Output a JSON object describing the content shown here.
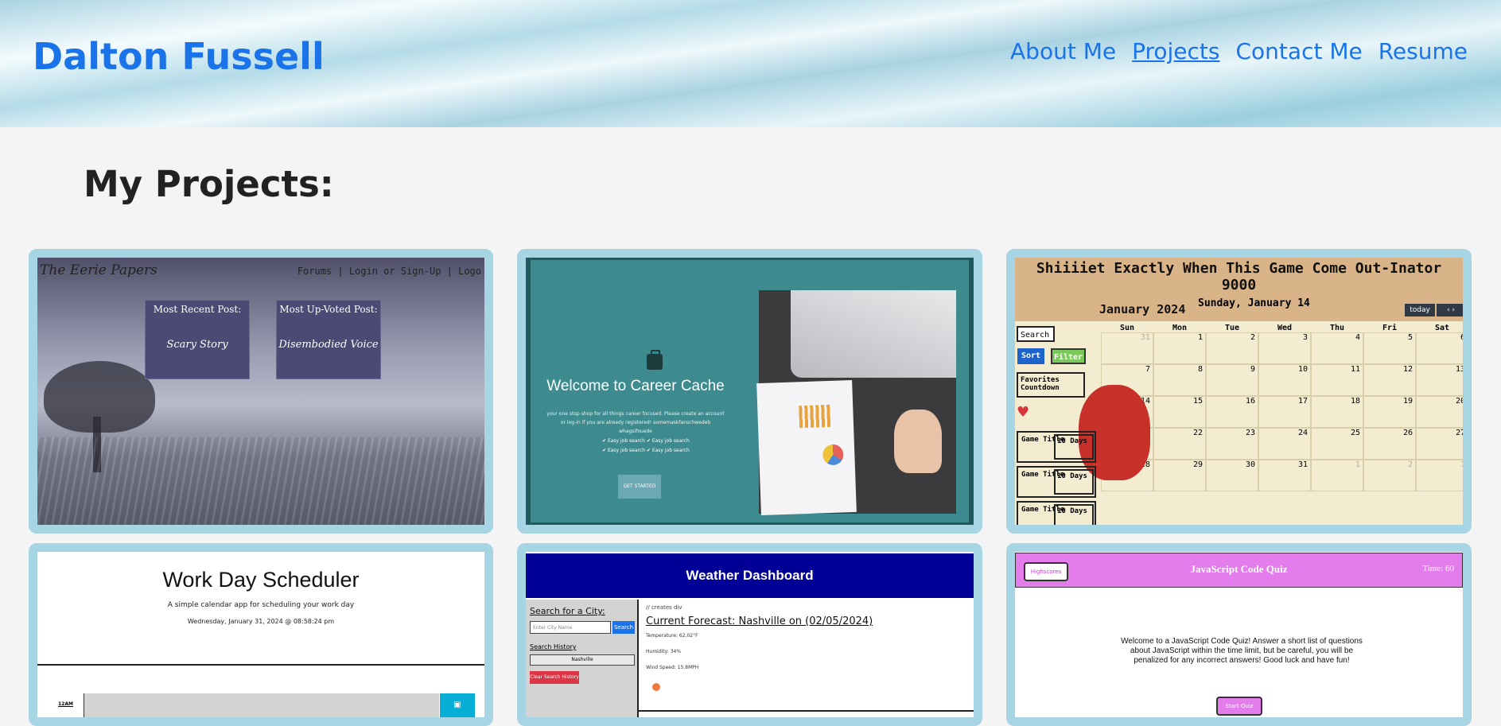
{
  "header": {
    "site_title": "Dalton Fussell",
    "nav": [
      "About Me",
      "Projects",
      "Contact Me",
      "Resume"
    ],
    "active_nav": "Projects"
  },
  "main": {
    "section_title": "My Projects:"
  },
  "projects": [
    {
      "brand": "The Eerie Papers",
      "nav_text": "Forums | Login or Sign-Up | Logo",
      "post1_heading": "Most Recent Post:",
      "post1_name": "Scary Story",
      "post2_heading": "Most Up-Voted Post:",
      "post2_name": "Disembodied Voice"
    },
    {
      "welcome": "Welcome to Career Cache",
      "description": "your one stop shop for all things career focused. Please create an account or log-in if you are already registered! somemaskfanschwedeb whagsifouede",
      "check1": "Easy job search",
      "check2": "Easy job search",
      "check3": "Easy job search",
      "check4": "Easy job search",
      "button": "GET STARTED"
    },
    {
      "title": "Shiiiiet Exactly When This Game Come Out-Inator 9000",
      "day": "Sunday, January 14",
      "month": "January 2024",
      "today_button": "today",
      "arrows": "‹  ›",
      "search_placeholder": "Search",
      "sort_button": "Sort",
      "filter_button": "Filter",
      "favorites": "Favorites Countdown",
      "games": [
        {
          "title": "Game Title",
          "days": "10 Days"
        },
        {
          "title": "Game Title",
          "days": "10 Days"
        },
        {
          "title": "Game Title",
          "days": "10 Days"
        }
      ],
      "weekdays": [
        "Sun",
        "Mon",
        "Tue",
        "Wed",
        "Thu",
        "Fri",
        "Sat"
      ],
      "days": [
        "31",
        "1",
        "2",
        "3",
        "4",
        "5",
        "6",
        "7",
        "8",
        "9",
        "10",
        "11",
        "12",
        "13",
        "14",
        "15",
        "16",
        "17",
        "18",
        "19",
        "20",
        "21",
        "22",
        "23",
        "24",
        "25",
        "26",
        "27",
        "28",
        "29",
        "30",
        "31",
        "1",
        "2",
        "3"
      ]
    },
    {
      "title": "Work Day Scheduler",
      "subtitle": "A simple calendar app for scheduling your work day",
      "date": "Wednesday, January 31, 2024 @ 08:58:24 pm",
      "first_hour": "12AM"
    },
    {
      "banner": "Weather Dashboard",
      "search_title": "Search for a City:",
      "search_placeholder": "Enter City Name",
      "search_button": "Search",
      "history_title": "Search History",
      "history_item": "Nashville",
      "clear_button": "Clear Search History",
      "city_note": "// creates div",
      "forecast_title": "Current Forecast: Nashville on (02/05/2024)",
      "temperature": "Temperature: 62.02°F",
      "humidity": "Humidity: 34%",
      "wind": "Wind Speed: 15.8MPH"
    },
    {
      "highscores_button": "Highscores",
      "title": "JavaScript Code Quiz",
      "timer": "Time: 60",
      "intro": "Welcome to a JavaScript Code Quiz! Answer a short list of questions about JavaScript within the time limit, but be careful, you will be penalized for any incorrect answers! Good luck and have fun!",
      "start_button": "Start Quiz"
    }
  ]
}
